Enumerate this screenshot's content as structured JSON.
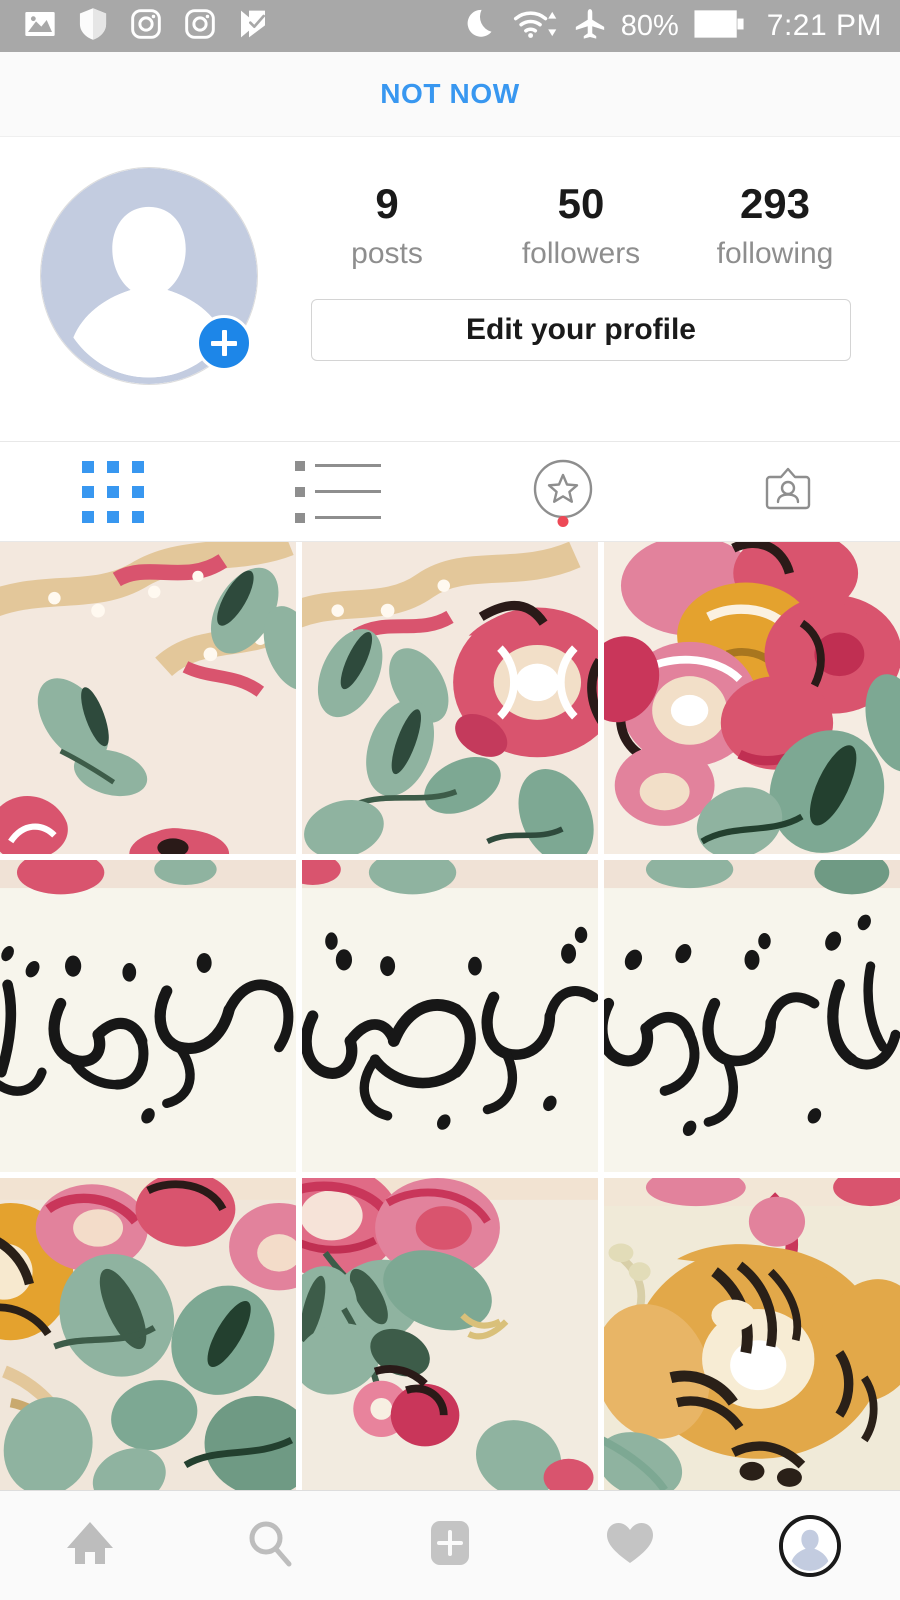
{
  "status_bar": {
    "left_icons": [
      {
        "name": "photo-icon",
        "label": "photo"
      },
      {
        "name": "shield-icon",
        "label": "shield"
      },
      {
        "name": "instagram-icon",
        "label": "instagram"
      },
      {
        "name": "instagram-icon-2",
        "label": "instagram"
      },
      {
        "name": "checkmark-flag-icon",
        "label": "checkmark flag"
      }
    ],
    "right_icons": [
      {
        "name": "moon-icon",
        "label": "do not disturb"
      },
      {
        "name": "wifi-icon",
        "label": "wifi"
      },
      {
        "name": "airplane-icon",
        "label": "airplane mode"
      }
    ],
    "battery_percent": "80%",
    "time": "7:21 PM",
    "background_color": "#a8a8a8",
    "foreground_color": "#ffffff"
  },
  "banner": {
    "not_now_label": "NOT NOW",
    "link_color": "#3897f0",
    "background_color": "#fafafa"
  },
  "profile": {
    "avatar": {
      "name": "profile-avatar",
      "has_add_badge": true,
      "badge_color": "#1d86e8",
      "silhouette_color": "#c3cce0"
    },
    "stats": [
      {
        "key": "posts",
        "value": "9",
        "label": "posts"
      },
      {
        "key": "followers",
        "value": "50",
        "label": "followers"
      },
      {
        "key": "following",
        "value": "293",
        "label": "following"
      }
    ],
    "edit_button_label": "Edit your profile"
  },
  "tabs": [
    {
      "key": "grid",
      "icon": "grid-icon",
      "label": "Grid view",
      "active": true,
      "badge": false,
      "active_color": "#3897f0"
    },
    {
      "key": "list",
      "icon": "list-icon",
      "label": "List view",
      "active": false,
      "badge": false
    },
    {
      "key": "saved",
      "icon": "star-circle-icon",
      "label": "Saved",
      "active": false,
      "badge": true,
      "badge_color": "#ed4956"
    },
    {
      "key": "tagged",
      "icon": "tagged-card-icon",
      "label": "Photos of you",
      "active": false,
      "badge": false
    }
  ],
  "photo_grid": {
    "columns": 3,
    "gap_color": "#ffffff",
    "cells": [
      {
        "index": 0,
        "name": "post-thumbnail-1",
        "type": "floral",
        "description": "Pale cream floral pattern with tan branch, sage leaves and pink blossom",
        "palette": {
          "bg": "#f3e8de",
          "leaf": "#8fb3a0",
          "leaf_dark": "#2e4a3c",
          "flower": "#d9546e",
          "branch": "#e3c79a"
        }
      },
      {
        "index": 1,
        "name": "post-thumbnail-2",
        "type": "floral",
        "description": "Cream background with tan branch and large pink rose at right",
        "palette": {
          "bg": "#f3e8de",
          "leaf": "#8fb3a0",
          "leaf_dark": "#2e4a3c",
          "flower": "#d9546e",
          "branch": "#e3c79a"
        }
      },
      {
        "index": 2,
        "name": "post-thumbnail-3",
        "type": "floral",
        "description": "Dense pink flowers with golden amber center and green leaves",
        "palette": {
          "bg": "#f5ece2",
          "leaf": "#7da893",
          "leaf_dark": "#23402f",
          "flower": "#d9546e",
          "gold": "#e0a13a"
        }
      },
      {
        "index": 3,
        "name": "post-thumbnail-4",
        "type": "calligraphy",
        "description": "Arabic calligraphy on ivory, left portion",
        "arabic_text": "خَيْرًا",
        "palette": {
          "bg": "#f7f5ec",
          "ink": "#1a1a1a"
        }
      },
      {
        "index": 4,
        "name": "post-thumbnail-5",
        "type": "calligraphy",
        "description": "Arabic calligraphy on ivory, middle portion",
        "arabic_text": "فِى قُلُوبِكُمْ",
        "palette": {
          "bg": "#f7f5ec",
          "ink": "#1a1a1a"
        }
      },
      {
        "index": 5,
        "name": "post-thumbnail-6",
        "type": "calligraphy",
        "description": "Arabic calligraphy on ivory, right portion",
        "arabic_text": "إِن يَعْلَمِ اللهُ",
        "palette": {
          "bg": "#f7f5ec",
          "ink": "#1a1a1a"
        }
      },
      {
        "index": 6,
        "name": "post-thumbnail-7",
        "type": "floral",
        "description": "Golden amber flower at left with pink blossoms and sage leaves",
        "palette": {
          "bg": "#f0e6da",
          "leaf": "#8fb3a0",
          "flower": "#d9546e",
          "gold": "#e0a13a"
        }
      },
      {
        "index": 7,
        "name": "post-thumbnail-8",
        "type": "floral",
        "description": "Pink roses with green leaves and small cherry berries",
        "palette": {
          "bg": "#f2ebe0",
          "leaf": "#8fb3a0",
          "leaf_dark": "#3d5c49",
          "flower": "#e06b86",
          "berry": "#c9365a"
        }
      },
      {
        "index": 8,
        "name": "post-thumbnail-9",
        "type": "floral",
        "description": "Large golden amber chrysanthemum with dark accents",
        "palette": {
          "bg": "#f0ead8",
          "gold": "#e2a849",
          "gold_dark": "#2a2018",
          "leaf": "#8fb3a0"
        }
      }
    ],
    "calligraphy_full_text": "إِن يَعْلَمِ اللهُ فِى قُلُوبِكُمْ خَيْرًا"
  },
  "bottom_nav": [
    {
      "key": "home",
      "name": "home-icon",
      "label": "Home",
      "active": false
    },
    {
      "key": "search",
      "name": "search-icon",
      "label": "Search",
      "active": false
    },
    {
      "key": "add",
      "name": "add-post-icon",
      "label": "New post",
      "active": false
    },
    {
      "key": "activity",
      "name": "heart-icon",
      "label": "Activity",
      "active": false
    },
    {
      "key": "profile",
      "name": "profile-nav-avatar",
      "label": "Profile",
      "active": true
    }
  ]
}
